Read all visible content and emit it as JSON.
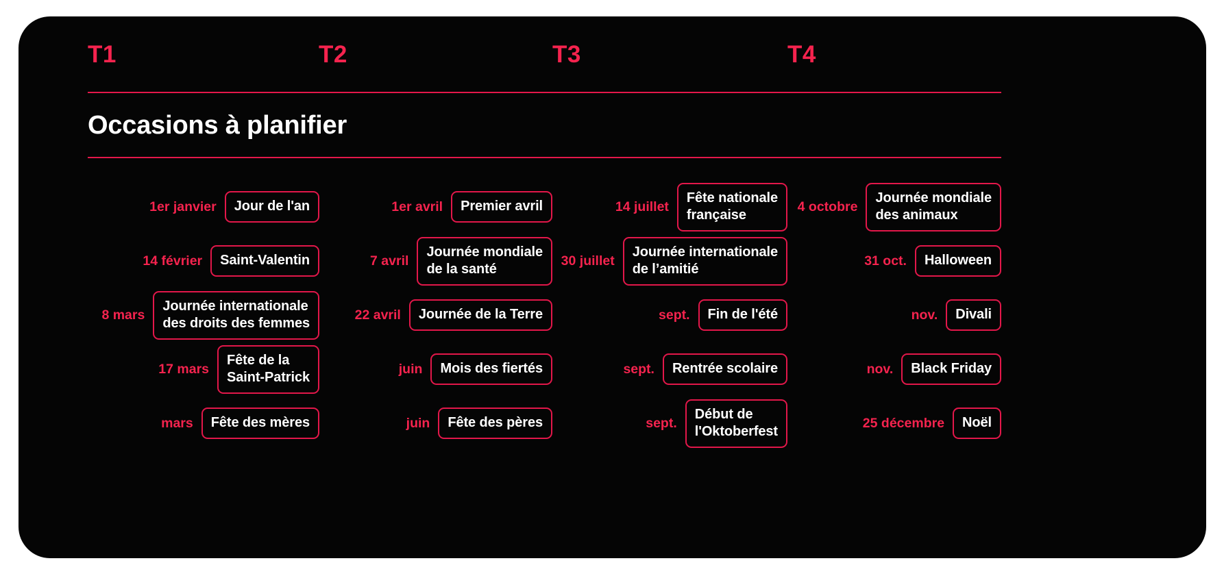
{
  "card": {
    "accent_color": "#f5234e",
    "line_color": "#e3174a",
    "background_color": "#050505",
    "text_color": "#ffffff"
  },
  "quarters": [
    {
      "label": "T1"
    },
    {
      "label": "T2"
    },
    {
      "label": "T3"
    },
    {
      "label": "T4"
    }
  ],
  "section": {
    "title": "Occasions à planifier"
  },
  "columns": [
    {
      "quarter": "T1",
      "rows": [
        {
          "date": "1er janvier",
          "occasion": "Jour de l'an"
        },
        {
          "date": "14 février",
          "occasion": "Saint-Valentin"
        },
        {
          "date": "8 mars",
          "occasion": "Journée internationale\ndes droits des femmes"
        },
        {
          "date": "17 mars",
          "occasion": "Fête de la\nSaint-Patrick"
        },
        {
          "date": "mars",
          "occasion": "Fête des mères"
        }
      ]
    },
    {
      "quarter": "T2",
      "rows": [
        {
          "date": "1er avril",
          "occasion": "Premier avril"
        },
        {
          "date": "7 avril",
          "occasion": "Journée mondiale\nde la santé"
        },
        {
          "date": "22 avril",
          "occasion": "Journée de la Terre"
        },
        {
          "date": "juin",
          "occasion": "Mois des fiertés"
        },
        {
          "date": "juin",
          "occasion": "Fête des pères"
        }
      ]
    },
    {
      "quarter": "T3",
      "rows": [
        {
          "date": "14 juillet",
          "occasion": "Fête nationale\nfrançaise"
        },
        {
          "date": "30 juillet",
          "occasion": "Journée internationale\nde l’amitié"
        },
        {
          "date": "sept.",
          "occasion": "Fin de l'été"
        },
        {
          "date": "sept.",
          "occasion": "Rentrée scolaire"
        },
        {
          "date": "sept.",
          "occasion": "Début de\nl'Oktoberfest"
        }
      ]
    },
    {
      "quarter": "T4",
      "rows": [
        {
          "date": "4 octobre",
          "occasion": "Journée mondiale\ndes animaux"
        },
        {
          "date": "31 oct.",
          "occasion": "Halloween"
        },
        {
          "date": "nov.",
          "occasion": "Divali"
        },
        {
          "date": "nov.",
          "occasion": "Black Friday"
        },
        {
          "date": "25 décembre",
          "occasion": "Noël"
        }
      ]
    }
  ]
}
